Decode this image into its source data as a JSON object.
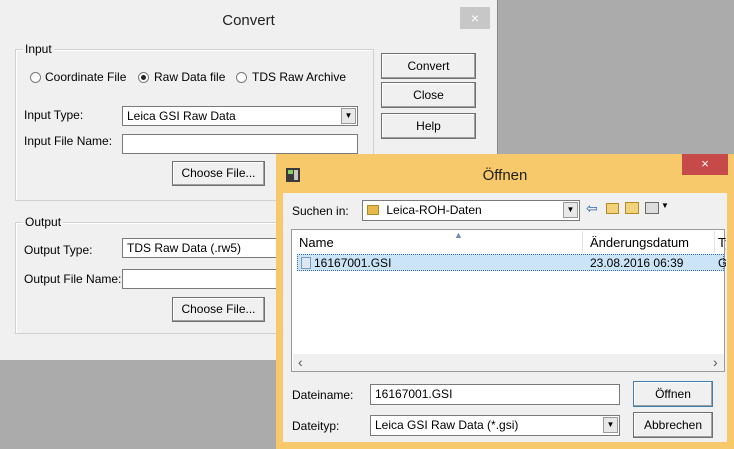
{
  "convert": {
    "title": "Convert",
    "close": "×",
    "input_group": "Input",
    "radio_coordinate": "Coordinate File",
    "radio_raw": "Raw Data file",
    "radio_tds": "TDS Raw Archive",
    "input_type_label": "Input Type:",
    "input_type_value": "Leica GSI Raw Data",
    "input_file_label": "Input File Name:",
    "choose_file_1": "Choose File...",
    "output_group": "Output",
    "output_type_label": "Output Type:",
    "output_type_value": "TDS Raw Data (.rw5)",
    "output_file_label": "Output File Name:",
    "choose_file_2": "Choose File...",
    "btn_convert": "Convert",
    "btn_close": "Close",
    "btn_help": "Help"
  },
  "open": {
    "title": "Öffnen",
    "close": "×",
    "lookin_label": "Suchen in:",
    "lookin_value": "Leica-ROH-Daten",
    "col_name": "Name",
    "col_date": "Änderungsdatum",
    "col_type": "Ty",
    "files": [
      {
        "name": "16167001.GSI",
        "date": "23.08.2016 06:39",
        "type": "G!"
      }
    ],
    "filename_label": "Dateiname:",
    "filename_value": "16167001.GSI",
    "filetype_label": "Dateityp:",
    "filetype_value": "Leica GSI Raw Data (*.gsi)",
    "btn_open": "Öffnen",
    "btn_cancel": "Abbrechen"
  }
}
